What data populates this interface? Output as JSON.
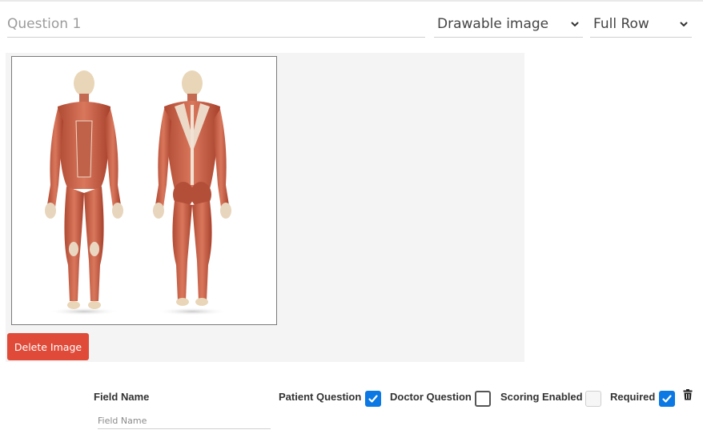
{
  "question": {
    "placeholder": "Question 1",
    "value": ""
  },
  "type_select": {
    "selected": "Drawable image"
  },
  "width_select": {
    "selected": "Full Row"
  },
  "image": {
    "delete_label": "Delete Image"
  },
  "field_name": {
    "label": "Field Name",
    "placeholder": "Field Name",
    "value": ""
  },
  "flags": [
    {
      "label": "Patient Question",
      "checked": true
    },
    {
      "label": "Doctor Question",
      "checked": false
    },
    {
      "label": "Scoring Enabled",
      "checked": false,
      "disabled": true
    },
    {
      "label": "Required",
      "checked": true
    }
  ],
  "colors": {
    "accent": "#0b78e3",
    "danger": "#e04a38"
  },
  "icons": {
    "dropdown": "chevron-down-icon",
    "delete": "trash-icon",
    "check": "checkmark-icon"
  }
}
